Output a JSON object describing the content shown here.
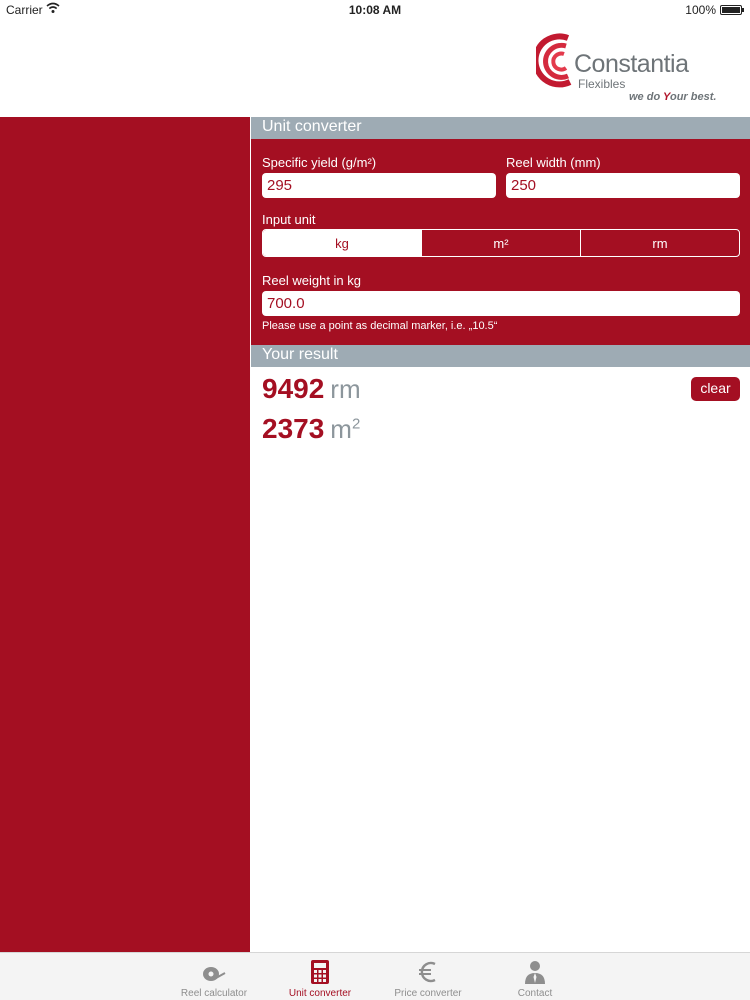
{
  "status_bar": {
    "carrier": "Carrier",
    "time": "10:08 AM",
    "battery": "100%"
  },
  "logo": {
    "name": "Constantia",
    "sub": "Flexibles",
    "tag_pre": "we do ",
    "tag_y": "Y",
    "tag_post": "our best."
  },
  "converter": {
    "title": "Unit converter",
    "specific_yield_label": "Specific yield (g/m²)",
    "specific_yield_value": "295",
    "reel_width_label": "Reel width (mm)",
    "reel_width_value": "250",
    "input_unit_label": "Input unit",
    "units": [
      "kg",
      "m²",
      "rm"
    ],
    "selected_unit": "kg",
    "weight_label": "Reel weight in kg",
    "weight_value": "700.0",
    "hint": "Please use a point as decimal marker, i.e. „10.5“"
  },
  "result": {
    "title": "Your result",
    "rm_value": "9492",
    "rm_unit": "rm",
    "m2_value": "2373",
    "m2_unit": "m",
    "m2_sup": "2",
    "clear_label": "clear"
  },
  "tabs": [
    {
      "label": "Reel calculator",
      "icon": "reel-icon"
    },
    {
      "label": "Unit converter",
      "icon": "calculator-icon",
      "active": true
    },
    {
      "label": "Price converter",
      "icon": "euro-icon"
    },
    {
      "label": "Contact",
      "icon": "person-icon"
    }
  ],
  "colors": {
    "brand_red": "#a40f22",
    "header_gray": "#9eabb4"
  }
}
